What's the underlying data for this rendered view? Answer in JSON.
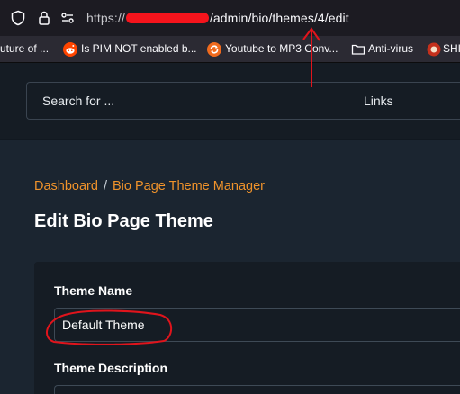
{
  "browser": {
    "url_prefix": "https://",
    "url_path": "/admin/bio/themes/4/edit",
    "bookmarks": [
      {
        "label": "uture of ..."
      },
      {
        "label": "Is PIM NOT enabled b..."
      },
      {
        "label": "Youtube to MP3 Conv..."
      },
      {
        "label": "Anti-virus"
      },
      {
        "label": "SHI"
      }
    ]
  },
  "header": {
    "search_placeholder": "Search for ...",
    "search_scope": "Links"
  },
  "breadcrumb": {
    "items": [
      "Dashboard",
      "Bio Page Theme Manager"
    ],
    "separator": "/"
  },
  "page": {
    "title": "Edit Bio Page Theme"
  },
  "form": {
    "theme_name_label": "Theme Name",
    "theme_name_value": "Default Theme",
    "theme_description_label": "Theme Description"
  },
  "colors": {
    "accent": "#f0932b",
    "annotation": "#e0141c"
  }
}
